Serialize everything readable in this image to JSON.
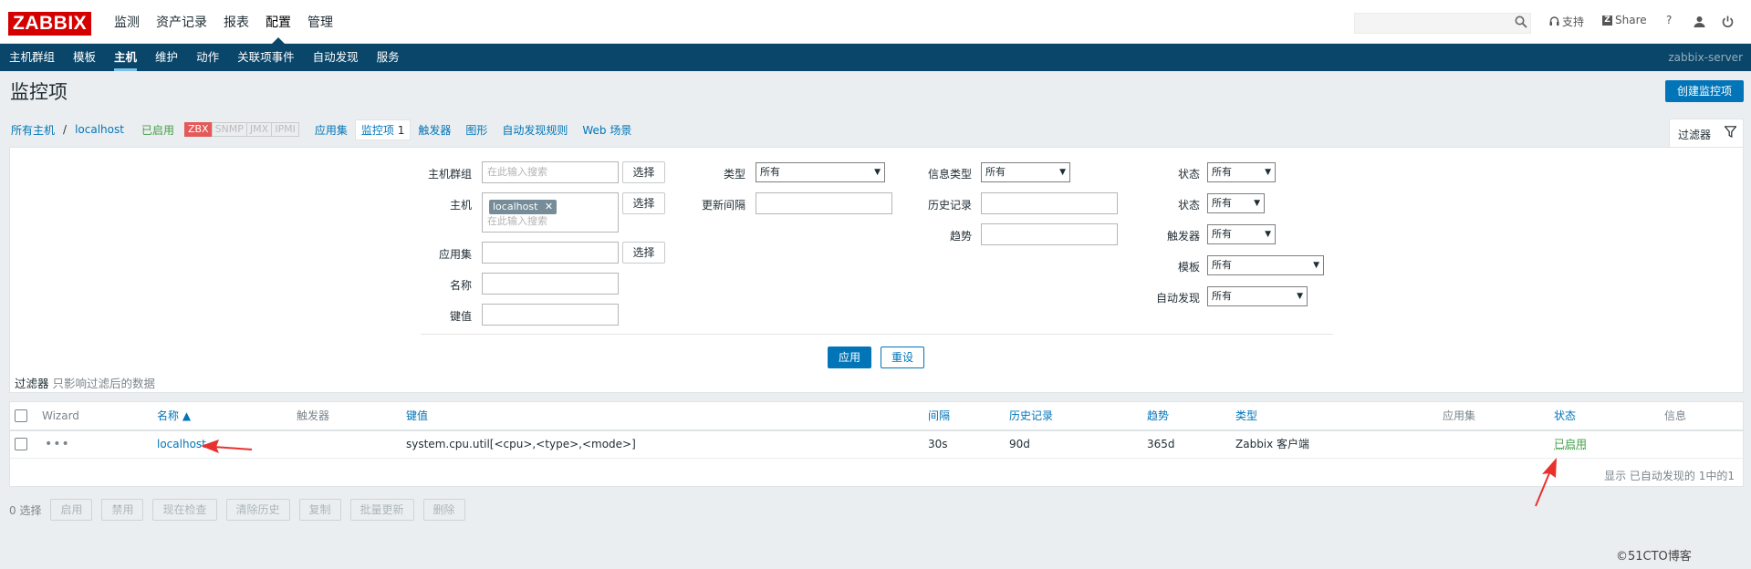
{
  "logo": "ZABBIX",
  "main_nav": [
    "监测",
    "资产记录",
    "报表",
    "配置",
    "管理"
  ],
  "main_nav_active": 3,
  "top_right": {
    "support": "支持",
    "share": "Share",
    "help": "?"
  },
  "sub_nav": [
    "主机群组",
    "模板",
    "主机",
    "维护",
    "动作",
    "关联项事件",
    "自动发现",
    "服务"
  ],
  "sub_nav_active": 2,
  "server_name": "zabbix-server",
  "page_title": "监控项",
  "create_button": "创建监控项",
  "breadcrumb": {
    "all_hosts": "所有主机",
    "separator": "/",
    "host": "localhost",
    "enabled": "已启用",
    "tags": [
      "ZBX",
      "SNMP",
      "JMX",
      "IPMI"
    ],
    "tabs": [
      {
        "label": "应用集",
        "count": ""
      },
      {
        "label": "监控项",
        "count": "1"
      },
      {
        "label": "触发器",
        "count": ""
      },
      {
        "label": "图形",
        "count": ""
      },
      {
        "label": "自动发现规则",
        "count": ""
      },
      {
        "label": "Web 场景",
        "count": ""
      }
    ]
  },
  "filter": {
    "tab_label": "过滤器",
    "host_group_label": "主机群组",
    "host_label": "主机",
    "app_label": "应用集",
    "name_label": "名称",
    "key_label": "键值",
    "search_placeholder": "在此输入搜索",
    "select_button": "选择",
    "host_value": "localhost",
    "type_label": "类型",
    "type_value": "所有",
    "update_interval_label": "更新间隔",
    "info_type_label": "信息类型",
    "info_type_value": "所有",
    "history_label": "历史记录",
    "trends_label": "趋势",
    "state_label": "状态",
    "state_value": "所有",
    "status_label": "状态",
    "status_value": "所有",
    "triggers_label": "触发器",
    "triggers_value": "所有",
    "template_label": "模板",
    "template_value": "所有",
    "discovery_label": "自动发现",
    "discovery_value": "所有",
    "apply": "应用",
    "reset": "重设",
    "note_bold": "过滤器",
    "note_rest": "只影响过滤后的数据"
  },
  "table": {
    "columns": [
      "Wizard",
      "名称 ▲",
      "触发器",
      "键值",
      "间隔",
      "历史记录",
      "趋势",
      "类型",
      "应用集",
      "状态",
      "信息"
    ],
    "rows": [
      {
        "wizard": "•••",
        "name": "localhost",
        "triggers": "",
        "key": "system.cpu.util[<cpu>,<type>,<mode>]",
        "interval": "30s",
        "history": "90d",
        "trends": "365d",
        "type": "Zabbix 客户端",
        "apps": "",
        "status": "已启用",
        "info": ""
      }
    ],
    "footer": "显示 已自动发现的 1中的1"
  },
  "bottom_bar": {
    "selected": "0 选择",
    "buttons": [
      "启用",
      "禁用",
      "现在检查",
      "清除历史",
      "复制",
      "批量更新",
      "删除"
    ]
  },
  "watermark": "©51CTO博客",
  "colors": {
    "brand": "#d40000",
    "nav": "#0a466a",
    "link": "#0275b8",
    "enabled": "#429e47",
    "arrow": "#e8312f"
  }
}
